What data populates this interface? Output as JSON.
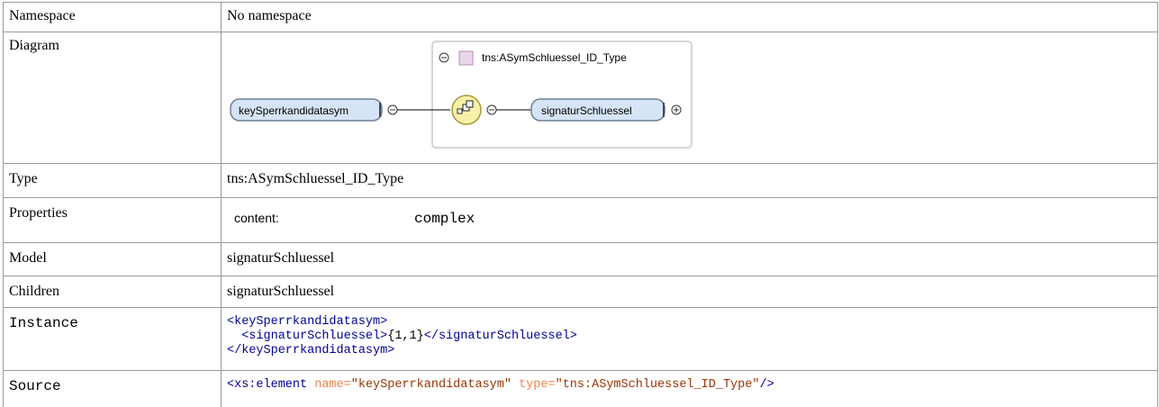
{
  "rows": {
    "namespace": {
      "label": "Namespace",
      "value": "No namespace"
    },
    "diagram": {
      "label": "Diagram",
      "element_name": "keySperrkandidatasym",
      "type_name": "tns:ASymSchluessel_ID_Type",
      "child_name": "signaturSchluessel",
      "colors": {
        "node_fill": "#d6e4f7",
        "node_stroke": "#7a8fa8",
        "sequence_fill": "#f7f0a8",
        "type_box": "#e8d5e8"
      },
      "icons": [
        "collapse-icon",
        "sequence-icon",
        "expand-icon"
      ]
    },
    "type": {
      "label": "Type",
      "value": "tns:ASymSchluessel_ID_Type"
    },
    "properties": {
      "label": "Properties",
      "key": "content:",
      "value": "complex"
    },
    "model": {
      "label": "Model",
      "value": "signaturSchluessel"
    },
    "children": {
      "label": "Children",
      "value": "signaturSchluessel"
    },
    "instance": {
      "label": "Instance",
      "line1": "<keySperrkandidatasym>",
      "line2_open": "<signaturSchluessel>",
      "line2_text": "{1,1}",
      "line2_close": "</signaturSchluessel>",
      "line3": "</keySperrkandidatasym>"
    },
    "source": {
      "label": "Source",
      "open": "<xs:element",
      "attr1_name": "name=",
      "attr1_value": "\"keySperrkandidatasym\"",
      "attr2_name": "type=",
      "attr2_value": "\"tns:ASymSchluessel_ID_Type\"",
      "close": "/>"
    }
  }
}
